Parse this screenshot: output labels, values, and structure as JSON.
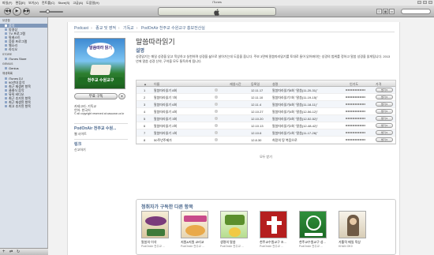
{
  "window": {
    "title": "iTunes"
  },
  "menu": [
    "파일(F)",
    "편집(E)",
    "보기(V)",
    "컨트롤(C)",
    "Store(S)",
    "고급(A)",
    "도움말(H)"
  ],
  "toolbar": {
    "prev": "◀◀",
    "play": "▶",
    "next": "▶▶",
    "logo": ""
  },
  "sidebar": {
    "sections": [
      {
        "header": "보관함",
        "items": [
          "음악",
          "동영상",
          "TV 프로그램",
          "팟캐스트",
          "응용 프로그램",
          "벨소리",
          "라디오"
        ]
      },
      {
        "header": "STORE",
        "items": [
          "iTunes Store"
        ]
      },
      {
        "header": "GENIUS",
        "items": [
          "Genius"
        ]
      },
      {
        "header": "재생목록",
        "items": [
          "iTunes DJ",
          "90년대 음악",
          "최근 재생한 항목",
          "클래식 음악",
          "뮤직 비디오",
          "최근 추가된 항목",
          "최근 재생된 항목",
          "최고 추가된 항목"
        ]
      }
    ],
    "selected": "음악"
  },
  "breadcrumb": [
    "Podcast",
    "종교 및 영적",
    "기독교",
    "PodOnAir 천주교 수원교구 홍보전산실"
  ],
  "podcast": {
    "cover_title": "말씀따라 읽기",
    "cover_org": "천주교 수원교구",
    "subscribe": "무료 구독",
    "category": "카테고리: 기독교",
    "language": "언어: 한국어",
    "copyright": "© all copyright reserved at casuwon.or.kr",
    "provider_title": "PodOnAir 천주교 수원...",
    "provider_link": "웹 사이트",
    "links_title": "링크",
    "links_item": "신고하기",
    "title": "말씀따라읽기",
    "desc_head": "설명",
    "description": "성경읽기는 매일 성경을 읽고 묵상하고 실천하며 성경을 삶으로 살아가는데 도움을 줍니다. 주보 3면에 말씀따라읽기를 토대로 들어 읽어봐야는 성경의 범위를 정하고 말씀 성경을 읽게됩니다. 2013년에 말씀 성경 신약, 구약을 모두 통독하게 됩니다."
  },
  "episodes": {
    "headers": {
      "num": "▲",
      "name": "이름",
      "time": "재생시간",
      "date": "등록일",
      "desc": "설명",
      "popularity": "인기도",
      "price": "가격"
    },
    "rows": [
      {
        "num": "1",
        "name": "말씀따라읽기 8회",
        "time": "",
        "date": "12.11.17",
        "desc": "말씀따라읽기8회 \"말씀(11-20-31)\"",
        "btn": "받기 ▾"
      },
      {
        "num": "2",
        "name": "말씀따라읽기 7회",
        "time": "",
        "date": "12.11.10",
        "desc": "말씀따라읽기7회 \"말씀(11-19-15)\"",
        "btn": "받기 ▾"
      },
      {
        "num": "3",
        "name": "말씀따라읽기 6회",
        "time": "",
        "date": "12.11.4",
        "desc": "말씀따라읽기6회 \"말씀(11-18-11)\"",
        "btn": "받기 ▾"
      },
      {
        "num": "4",
        "name": "말씀따라읽기 4회",
        "time": "",
        "date": "12.10.27",
        "desc": "말씀따라읽기4회 \"말씀(12-56-12)\"",
        "btn": "받기 ▾"
      },
      {
        "num": "5",
        "name": "말씀따라읽기 3회",
        "time": "",
        "date": "12.10.20",
        "desc": "말씀따라읽기3회 \"말씀(12-52-52)\"",
        "btn": "받기 ▾"
      },
      {
        "num": "6",
        "name": "말씀따라읽기 2회",
        "time": "",
        "date": "12.10.13",
        "desc": "말씀따라읽기2회 \"말씀(12-48-42)\"",
        "btn": "받기 ▾"
      },
      {
        "num": "7",
        "name": "말씀따라읽기 1회",
        "time": "",
        "date": "12.10.6",
        "desc": "말씀따라읽기1회 \"말씀(11-17-26)\"",
        "btn": "받기 ▾"
      },
      {
        "num": "8",
        "name": "50주년주제가",
        "time": "",
        "date": "12.8.30",
        "desc": "희망의 땅 복음으로",
        "btn": "받기 ▾"
      }
    ],
    "all": "모두 받기"
  },
  "also": {
    "title": "청취자가 구독한 다른 항목",
    "items": [
      {
        "name": "말씀의 이삭",
        "sub": "PodOnAir 천주교 ..."
      },
      {
        "name": "지원&지원 교리교",
        "sub": "PodOnAir 천주교 ..."
      },
      {
        "name": "생명의 말씀",
        "sub": "PodOnAir 천주교 ..."
      },
      {
        "name": "천주교수원교구 조...",
        "sub": "PodOnAir 천주교 ..."
      },
      {
        "name": "천주교수원교구 성...",
        "sub": "PodOnAir 천주교 ..."
      },
      {
        "name": "가톨릭 매일 묵상",
        "sub": "KHAN OK0"
      }
    ]
  }
}
